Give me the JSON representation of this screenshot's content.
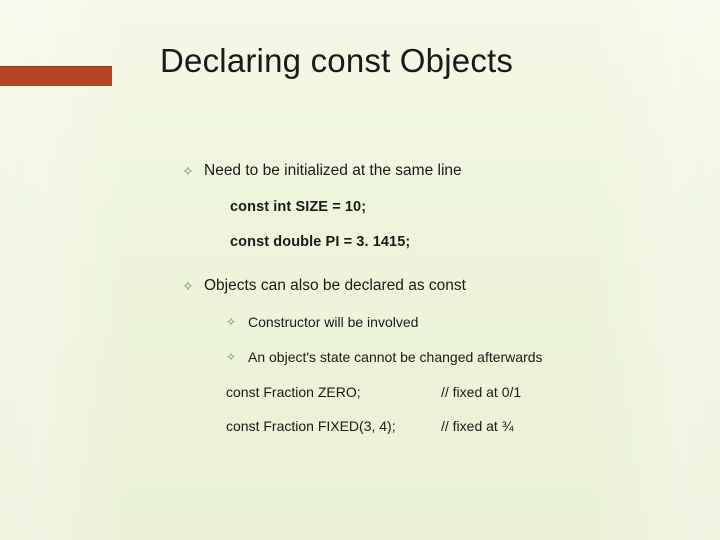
{
  "title": "Declaring const Objects",
  "bullets": {
    "b1": {
      "text": "Need to be initialized at the same line",
      "code1": "const int SIZE = 10;",
      "code2": "const double PI = 3. 1415;"
    },
    "b2": {
      "text": "Objects can also be declared as const",
      "sub1": "Constructor will be involved",
      "sub2": "An object's state cannot be changed afterwards",
      "row1": {
        "code": "const Fraction ZERO;",
        "comment": "// fixed at 0/1"
      },
      "row2": {
        "code": "const Fraction FIXED(3, 4);",
        "comment": "// fixed at ¾"
      }
    }
  }
}
